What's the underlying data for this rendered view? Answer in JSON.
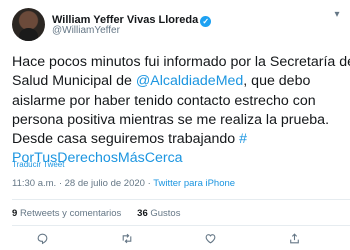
{
  "author": {
    "display_name": "William Yeffer Vivas Lloreda",
    "handle": "@WilliamYeffer",
    "verified_icon": "✓"
  },
  "tweet": {
    "line1": "Hace pocos minutos fui informado por la Secretaría de",
    "line2_prefix": "Salud Municipal de ",
    "mention": "@AlcaldiadeMed",
    "line2_suffix": ", que debo",
    "line3": "aislarme por haber tenido contacto estrecho con",
    "line4": "persona positiva mientras se me realiza la prueba.",
    "line5_prefix": "Desde casa seguiremos trabajando ",
    "hashtag_part1": "#",
    "hashtag_part2": "PorTusDerechosMásCerca"
  },
  "translate_label": "Traducir Tweet",
  "meta": {
    "time": "11:30 a.m.",
    "separator": " · ",
    "date": "28 de julio de 2020",
    "source": "Twitter para iPhone"
  },
  "stats": {
    "retweets_count": "9",
    "retweets_label": "Retweets y comentarios",
    "likes_count": "36",
    "likes_label": "Gustos"
  },
  "icons": {
    "caret": "chevron-down-icon",
    "reply": "reply-icon",
    "retweet": "retweet-icon",
    "like": "heart-icon",
    "share": "share-icon"
  },
  "colors": {
    "link": "#1b95e0",
    "muted": "#657786",
    "text": "#14171a",
    "verified": "#1da1f2"
  }
}
